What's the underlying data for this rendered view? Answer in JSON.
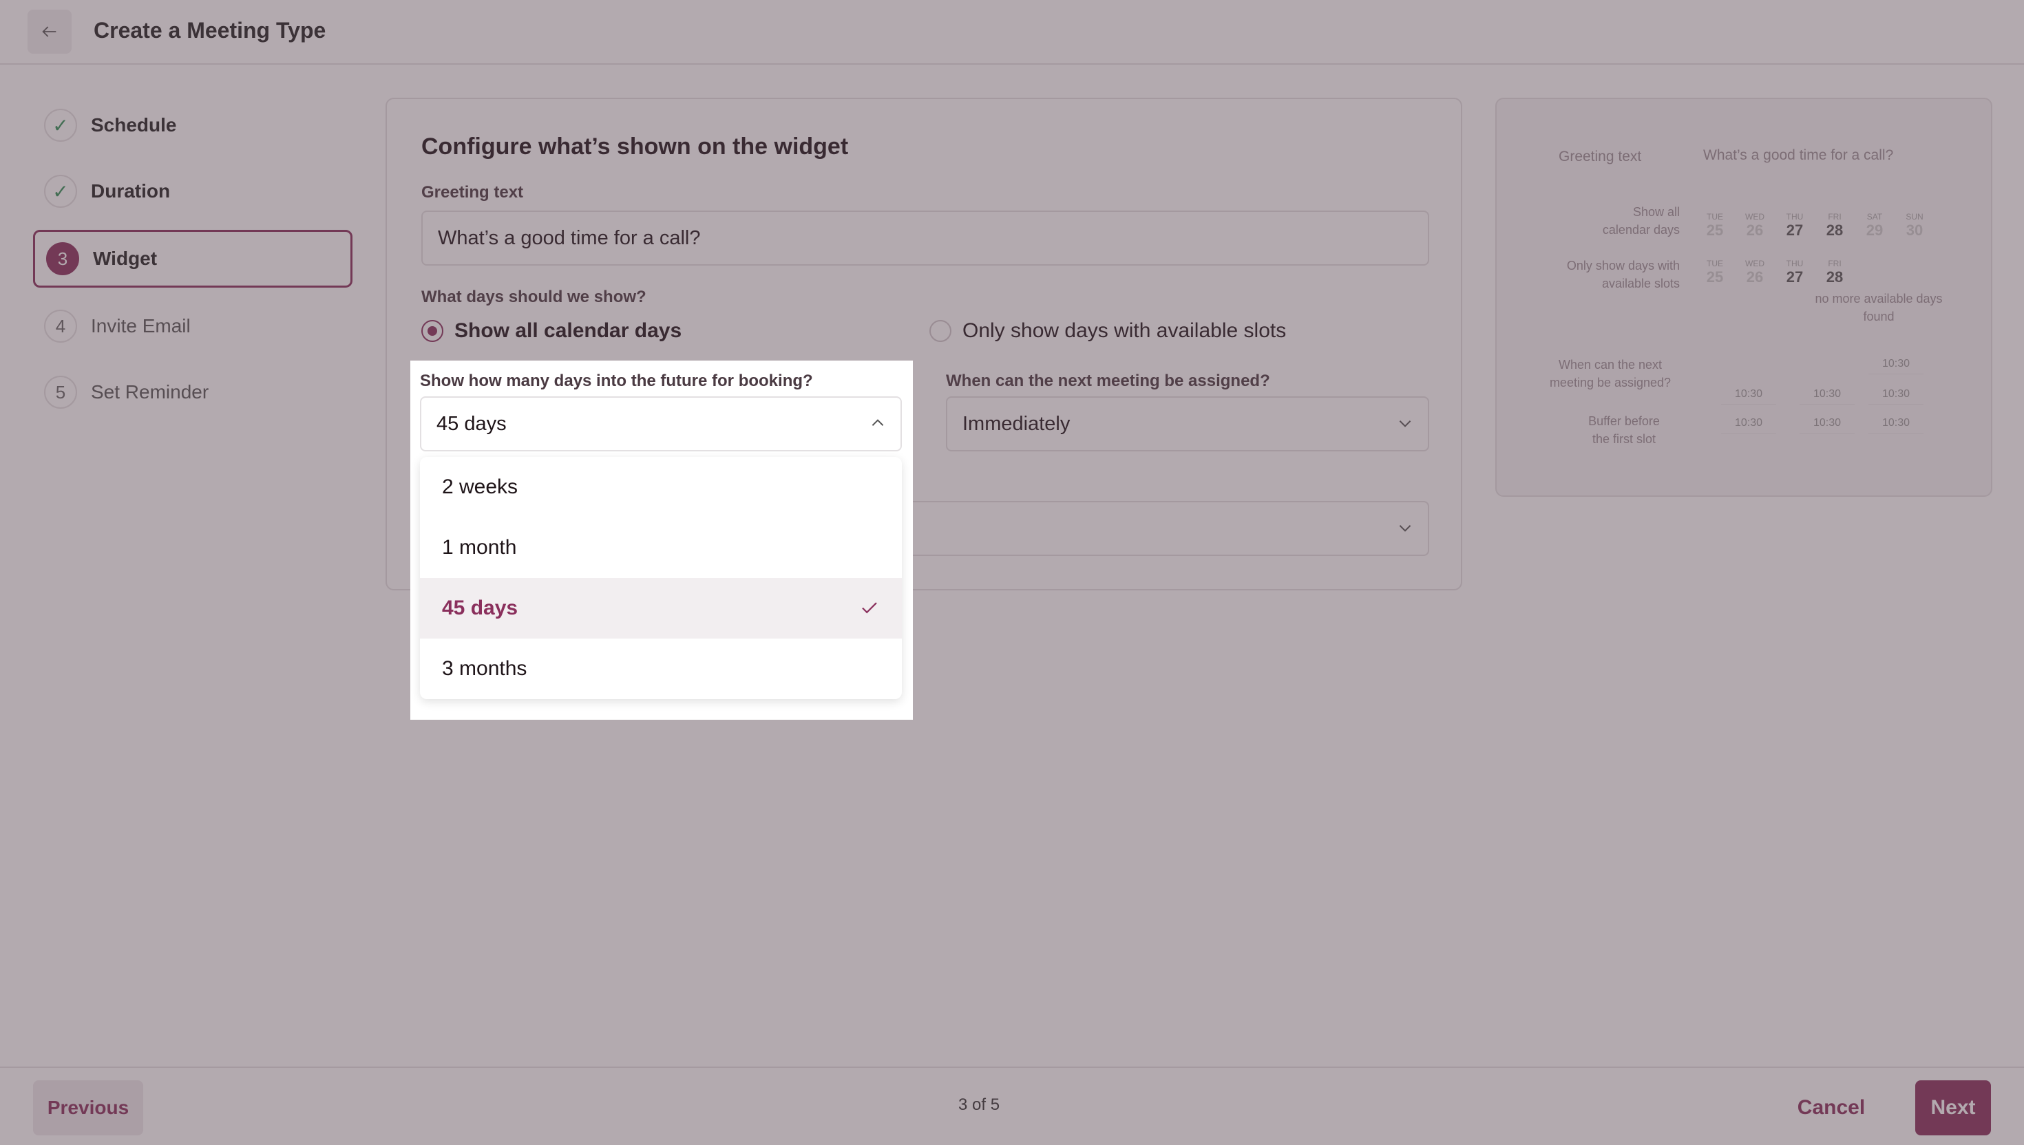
{
  "header": {
    "title": "Create a Meeting Type",
    "back_icon": "arrow-left-icon"
  },
  "sidebar": {
    "steps": [
      {
        "badge": "✓",
        "label": "Schedule",
        "state": "done"
      },
      {
        "badge": "✓",
        "label": "Duration",
        "state": "done"
      },
      {
        "badge": "3",
        "label": "Widget",
        "state": "active"
      },
      {
        "badge": "4",
        "label": "Invite Email",
        "state": "pending"
      },
      {
        "badge": "5",
        "label": "Set Reminder",
        "state": "pending"
      }
    ]
  },
  "form": {
    "title": "Configure what’s shown on the widget",
    "greeting_label": "Greeting text",
    "greeting_value": "What’s a good time for a call?",
    "days_label": "What days should we show?",
    "radio_all": "Show all calendar days",
    "radio_available": "Only show days with available slots",
    "future_label": "Show how many days into the future for booking?",
    "future_value": "45 days",
    "next_label": "When can the next meeting be assigned?",
    "next_value": "Immediately",
    "dropdown_options": [
      "2 weeks",
      "1 month",
      "45 days",
      "3 months"
    ],
    "selected_option": "45 days"
  },
  "preview": {
    "greeting_label": "Greeting text",
    "greeting_value": "What’s a good time for a call?",
    "show_all_1": "Show all",
    "show_all_2": "calendar days",
    "only_show_1": "Only show days with",
    "only_show_2": "available slots",
    "no_more_1": "no more available days",
    "no_more_2": "found",
    "next_q_1": "When can the next",
    "next_q_2": "meeting be assigned?",
    "buffer_1": "Buffer before",
    "buffer_2": "the first slot",
    "row1_days": [
      {
        "dow": "TUE",
        "num": "25"
      },
      {
        "dow": "WED",
        "num": "26"
      },
      {
        "dow": "THU",
        "num": "27"
      },
      {
        "dow": "FRI",
        "num": "28"
      },
      {
        "dow": "SAT",
        "num": "29"
      },
      {
        "dow": "SUN",
        "num": "30"
      }
    ],
    "row2_days": [
      {
        "dow": "TUE",
        "num": "25"
      },
      {
        "dow": "WED",
        "num": "26"
      },
      {
        "dow": "THU",
        "num": "27"
      },
      {
        "dow": "FRI",
        "num": "28"
      }
    ],
    "time": "10:30"
  },
  "footer": {
    "previous": "Previous",
    "pager": "3 of 5",
    "cancel": "Cancel",
    "next": "Next"
  }
}
